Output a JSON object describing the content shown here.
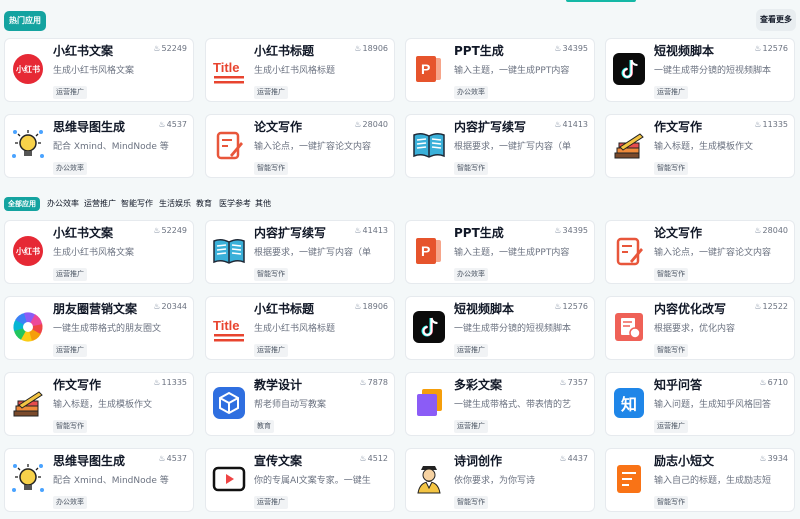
{
  "hot_section": {
    "tag": "热门应用",
    "more_label": "查看更多"
  },
  "hot_cards": [
    {
      "title": "小红书文案",
      "desc": "生成小红书风格文案",
      "tag": "运营推广",
      "count": "52249",
      "icon": "xiaohongshu-icon"
    },
    {
      "title": "小红书标题",
      "desc": "生成小红书风格标题",
      "tag": "运营推广",
      "count": "18906",
      "icon": "title-icon"
    },
    {
      "title": "PPT生成",
      "desc": "输入主题，一键生成PPT内容",
      "tag": "办公效率",
      "count": "34395",
      "icon": "ppt-icon"
    },
    {
      "title": "短视频脚本",
      "desc": "一键生成带分镜的短视频脚本",
      "tag": "运营推广",
      "count": "12576",
      "icon": "tiktok-icon"
    },
    {
      "title": "思维导图生成",
      "desc": "配合 Xmind、MindNode 等",
      "tag": "办公效率",
      "count": "4537",
      "icon": "lightbulb-icon"
    },
    {
      "title": "论文写作",
      "desc": "输入论点，一键扩容论文内容",
      "tag": "智能写作",
      "count": "28040",
      "icon": "paper-edit-icon"
    },
    {
      "title": "内容扩写续写",
      "desc": "根据要求，一键扩写内容（单",
      "tag": "智能写作",
      "count": "41413",
      "icon": "open-book-icon"
    },
    {
      "title": "作文写作",
      "desc": "输入标题，生成模板作文",
      "tag": "智能写作",
      "count": "11335",
      "icon": "books-pencil-icon"
    }
  ],
  "categories": {
    "active": "全部应用",
    "items": [
      "办公效率",
      "运营推广",
      "智能写作",
      "生活娱乐",
      "教育",
      "医学参考",
      "其他"
    ]
  },
  "all_cards": [
    {
      "title": "小红书文案",
      "desc": "生成小红书风格文案",
      "tag": "运营推广",
      "count": "52249",
      "icon": "xiaohongshu-icon"
    },
    {
      "title": "内容扩写续写",
      "desc": "根据要求，一键扩写内容（单",
      "tag": "智能写作",
      "count": "41413",
      "icon": "open-book-icon"
    },
    {
      "title": "PPT生成",
      "desc": "输入主题，一键生成PPT内容",
      "tag": "办公效率",
      "count": "34395",
      "icon": "ppt-icon"
    },
    {
      "title": "论文写作",
      "desc": "输入论点，一键扩容论文内容",
      "tag": "智能写作",
      "count": "28040",
      "icon": "paper-edit-icon"
    },
    {
      "title": "朋友圈营销文案",
      "desc": "一键生成带格式的朋友圈文",
      "tag": "运营推广",
      "count": "20344",
      "icon": "aperture-icon"
    },
    {
      "title": "小红书标题",
      "desc": "生成小红书风格标题",
      "tag": "运营推广",
      "count": "18906",
      "icon": "title-icon"
    },
    {
      "title": "短视频脚本",
      "desc": "一键生成带分镜的短视频脚本",
      "tag": "运营推广",
      "count": "12576",
      "icon": "tiktok-icon"
    },
    {
      "title": "内容优化改写",
      "desc": "根据要求，优化内容",
      "tag": "智能写作",
      "count": "12522",
      "icon": "doc-edit-icon"
    },
    {
      "title": "作文写作",
      "desc": "输入标题，生成模板作文",
      "tag": "智能写作",
      "count": "11335",
      "icon": "books-pencil-icon"
    },
    {
      "title": "教学设计",
      "desc": "帮老师自动写教案",
      "tag": "教育",
      "count": "7878",
      "icon": "cube-icon"
    },
    {
      "title": "多彩文案",
      "desc": "一键生成带格式、带表情的艺",
      "tag": "运营推广",
      "count": "7357",
      "icon": "layers-icon"
    },
    {
      "title": "知乎问答",
      "desc": "输入问题，生成知乎风格回答",
      "tag": "运营推广",
      "count": "6710",
      "icon": "zhihu-icon"
    },
    {
      "title": "思维导图生成",
      "desc": "配合 Xmind、MindNode 等",
      "tag": "办公效率",
      "count": "4537",
      "icon": "lightbulb-icon"
    },
    {
      "title": "宣传文案",
      "desc": "你的专属AI文案专家。一键生",
      "tag": "运营推广",
      "count": "4512",
      "icon": "video-play-icon"
    },
    {
      "title": "诗词创作",
      "desc": "依你要求，为你写诗",
      "tag": "智能写作",
      "count": "4437",
      "icon": "poet-icon"
    },
    {
      "title": "励志小短文",
      "desc": "输入自己的标题，生成励志短",
      "tag": "智能写作",
      "count": "3934",
      "icon": "orange-doc-icon"
    }
  ],
  "fire_glyph": "♨",
  "brand_colors": {
    "accent": "#14a3a0",
    "xiaohongshu": "#e62935",
    "ppt": "#e6542c",
    "zhihu": "#1f86e8"
  },
  "icon_text": {
    "xiaohongshu": "小红书",
    "title": "Title",
    "zhihu": "知"
  }
}
